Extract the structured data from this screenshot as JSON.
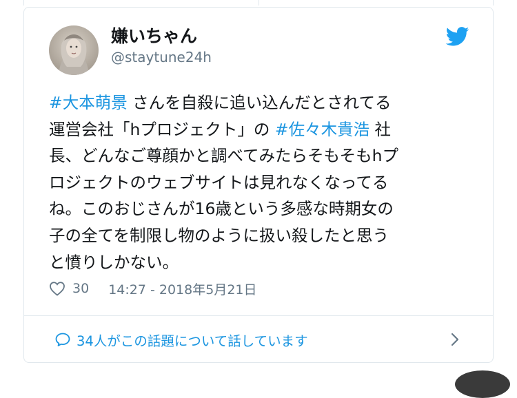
{
  "user": {
    "display_name": "嫌いちゃん",
    "username": "@staytune24h"
  },
  "tweet": {
    "lines": [
      [
        {
          "text": "#大本萌景",
          "hashtag": true
        },
        {
          "text": " さんを自殺に追い込んだとされてる",
          "hashtag": false
        }
      ],
      [
        {
          "text": "運営会社「hプロジェクト」の ",
          "hashtag": false
        },
        {
          "text": "#佐々木貴浩",
          "hashtag": true
        },
        {
          "text": " 社",
          "hashtag": false
        }
      ],
      [
        {
          "text": "長、どんなご尊顔かと調べてみたらそもそもhプ",
          "hashtag": false
        }
      ],
      [
        {
          "text": "ロジェクトのウェブサイトは見れなくなってる",
          "hashtag": false
        }
      ],
      [
        {
          "text": "ね。このおじさんが16歳という多感な時期女の",
          "hashtag": false
        }
      ],
      [
        {
          "text": "子の全てを制限し物のように扱い殺したと思う",
          "hashtag": false
        }
      ],
      [
        {
          "text": "と憤りしかない。",
          "hashtag": false
        }
      ]
    ],
    "like_count": "30",
    "timestamp": "14:27 - 2018年5月21日"
  },
  "conversation": {
    "label": "34人がこの話題について話しています"
  },
  "icons": {
    "brand": "twitter-bird-icon",
    "like": "heart-icon",
    "conversation": "speech-bubble-icon",
    "chevron": "chevron-right-icon"
  },
  "colors": {
    "link": "#1b95e0",
    "muted": "#657786",
    "text": "#14171a",
    "border": "#e1e8ed"
  }
}
